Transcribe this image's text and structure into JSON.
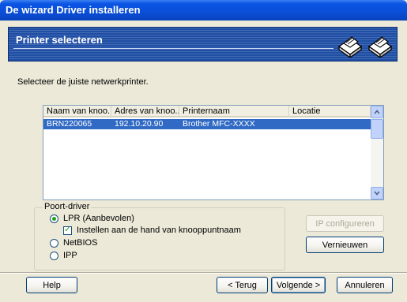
{
  "window": {
    "title": "De wizard Driver installeren"
  },
  "banner": {
    "title": "Printer selecteren",
    "icons": [
      "printer-icon",
      "printer-icon"
    ]
  },
  "instruction": "Selecteer de juiste netwerkprinter.",
  "printer_list": {
    "columns": [
      "Naam van knoo...",
      "Adres van knoo...",
      "Printernaam",
      "Locatie"
    ],
    "rows": [
      {
        "node_name": "BRN220065",
        "node_address": "192.10.20.90",
        "printer_name": "Brother MFC-XXXX",
        "location": ""
      }
    ]
  },
  "port_driver": {
    "label": "Poort-driver",
    "options": [
      {
        "label": "LPR (Aanbevolen)",
        "selected": true
      },
      {
        "label": "NetBIOS",
        "selected": false
      },
      {
        "label": "IPP",
        "selected": false
      }
    ],
    "manual_setting": {
      "label": "Instellen aan de hand van knooppuntnaam",
      "checked": true
    }
  },
  "buttons": {
    "ip_config": "IP configureren",
    "refresh": "Vernieuwen",
    "help": "Help",
    "back": "< Terug",
    "next": "Volgende >",
    "cancel": "Annuleren"
  },
  "colors": {
    "title_bar": "#0b55e4",
    "banner": "#1f4ea5",
    "selection": "#316ac5",
    "background": "#ece9d8"
  }
}
